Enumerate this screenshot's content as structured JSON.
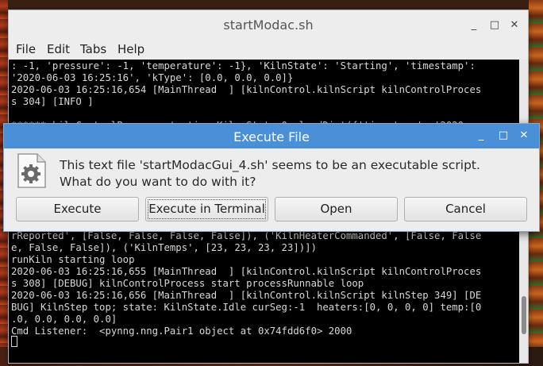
{
  "terminal": {
    "title": "startModac.sh",
    "menu": [
      "File",
      "Edit",
      "Tabs",
      "Help"
    ],
    "lines_top": [
      ": -1, 'pressure': -1, 'temperature': -1}, 'KilnState': 'Starting', 'timestamp':",
      "'2020-06-03 16:25:16', 'kType': [0.0, 0.0, 0.0]}",
      "2020-06-03 16:25:16,654 [MainThread  ] [kilnControl.kilnScript kilnControlProces",
      "s 304] [INFO ]",
      "",
      "****** kilnControlProcess starting Kiln State 0  loadDict({'timestamp': '2020"
    ],
    "lines_bottom": [
      "rReported', [False, False, False, False]), ('KilnHeaterCommanded', [False, False",
      "e, False, False]), ('KilnTemps', [23, 23, 23, 23])])",
      "runKiln starting loop",
      "2020-06-03 16:25:16,655 [MainThread  ] [kilnControl.kilnScript kilnControlProces",
      "s 308] [DEBUG] kilnControlProcess start processRunnable loop",
      "2020-06-03 16:25:16,656 [MainThread  ] [kilnControl.kilnScript kilnStep 349] [DE",
      "BUG] KilnStep top; state: KilnState.Idle curSeg:-1  heaters:[0, 0, 0, 0] temp:[0",
      ".0, 0.0, 0.0, 0.0]",
      "Cmd Listener:  <pynng.nng.Pair1 object at 0x74fdd6f0> 2000"
    ]
  },
  "dialog": {
    "title": "Execute File",
    "message_line1": "This text file 'startModacGui_4.sh' seems to be an executable script.",
    "message_line2": "What do you want to do with it?",
    "buttons": {
      "execute": "Execute",
      "execute_terminal": "Execute in Terminal",
      "open": "Open",
      "cancel": "Cancel"
    },
    "icon": "script-file-gear-icon"
  },
  "colors": {
    "dialog_titlebar": "#4a90d9",
    "terminal_bg": "#000000",
    "terminal_fg": "#d8d8d8"
  }
}
